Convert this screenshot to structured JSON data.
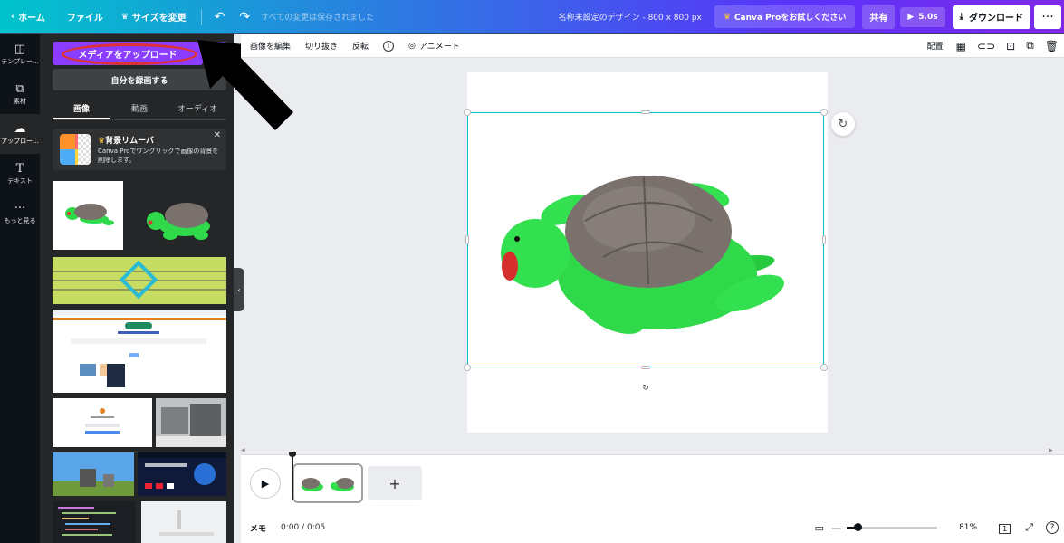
{
  "topbar": {
    "home": "ホーム",
    "file": "ファイル",
    "resize": "サイズを変更",
    "saved_status": "すべての変更は保存されました",
    "doc_title": "名称未設定のデザイン - 800 x 800 px",
    "try_pro": "Canva Proをお試しください",
    "share": "共有",
    "play_duration": "5.0s",
    "download": "ダウンロード"
  },
  "rail": {
    "items": [
      {
        "label": "テンプレー...",
        "icon": "template-icon"
      },
      {
        "label": "素材",
        "icon": "elements-icon"
      },
      {
        "label": "アップロー...",
        "icon": "upload-icon"
      },
      {
        "label": "テキスト",
        "icon": "text-icon"
      },
      {
        "label": "もっと見る",
        "icon": "more-icon"
      }
    ],
    "active_index": 2
  },
  "panel": {
    "upload_button": "メディアをアップロード",
    "record_button": "自分を録画する",
    "tabs": [
      "画像",
      "動画",
      "オーディオ"
    ],
    "active_tab": 0,
    "promo": {
      "title": "背景リムーバ",
      "text": "Canva Proでワンクリックで画像の背景を削除します。"
    }
  },
  "editor_toolbar": {
    "edit_image": "画像を編集",
    "crop": "切り抜き",
    "flip": "反転",
    "animate": "アニメート",
    "arrange": "配置"
  },
  "timeline": {
    "add_page": "+"
  },
  "bottombar": {
    "notes": "メモ",
    "time": "0:00 / 0:05",
    "zoom": "81%",
    "zoom_fraction": 0.12,
    "page_count": "1"
  },
  "colors": {
    "accent_purple": "#8b3dff",
    "selection": "#00c4cc",
    "turtle_green": "#2fd94a",
    "annotation_red": "#e03131"
  }
}
